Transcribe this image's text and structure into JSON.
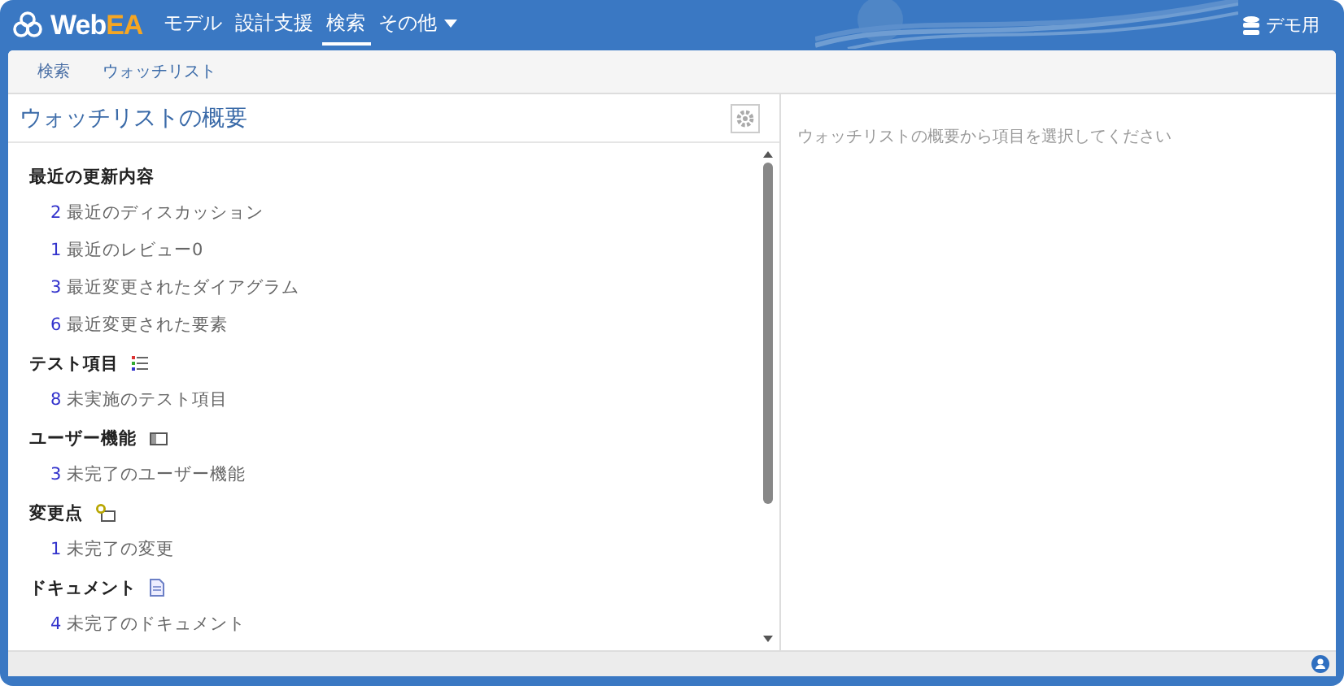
{
  "header": {
    "logo": {
      "part1": "Web",
      "part2": "EA"
    },
    "nav": [
      {
        "label": "モデル",
        "selected": false,
        "dropdown": false
      },
      {
        "label": "設計支援",
        "selected": false,
        "dropdown": false
      },
      {
        "label": "検索",
        "selected": true,
        "dropdown": false
      },
      {
        "label": "その他",
        "selected": false,
        "dropdown": true
      }
    ],
    "user": "デモ用"
  },
  "subtabs": [
    {
      "label": "検索",
      "selected": false
    },
    {
      "label": "ウォッチリスト",
      "selected": true
    }
  ],
  "left_panel": {
    "title": "ウォッチリストの概要",
    "sections": [
      {
        "heading": "最近の更新内容",
        "kind": "none",
        "items": [
          {
            "count": "2",
            "label": "最近のディスカッション"
          },
          {
            "count": "1",
            "label": "最近のレビュー0"
          },
          {
            "count": "3",
            "label": "最近変更されたダイアグラム"
          },
          {
            "count": "6",
            "label": "最近変更された要素"
          }
        ]
      },
      {
        "heading": "テスト項目",
        "kind": "list",
        "items": [
          {
            "count": "8",
            "label": "未実施のテスト項目"
          }
        ]
      },
      {
        "heading": "ユーザー機能",
        "kind": "panel",
        "items": [
          {
            "count": "3",
            "label": "未完了のユーザー機能"
          }
        ]
      },
      {
        "heading": "変更点",
        "kind": "change",
        "items": [
          {
            "count": "1",
            "label": "未完了の変更"
          }
        ]
      },
      {
        "heading": "ドキュメント",
        "kind": "document",
        "items": [
          {
            "count": "4",
            "label": "未完了のドキュメント"
          }
        ]
      }
    ]
  },
  "right_panel": {
    "message": "ウォッチリストの概要から項目を選択してください"
  }
}
